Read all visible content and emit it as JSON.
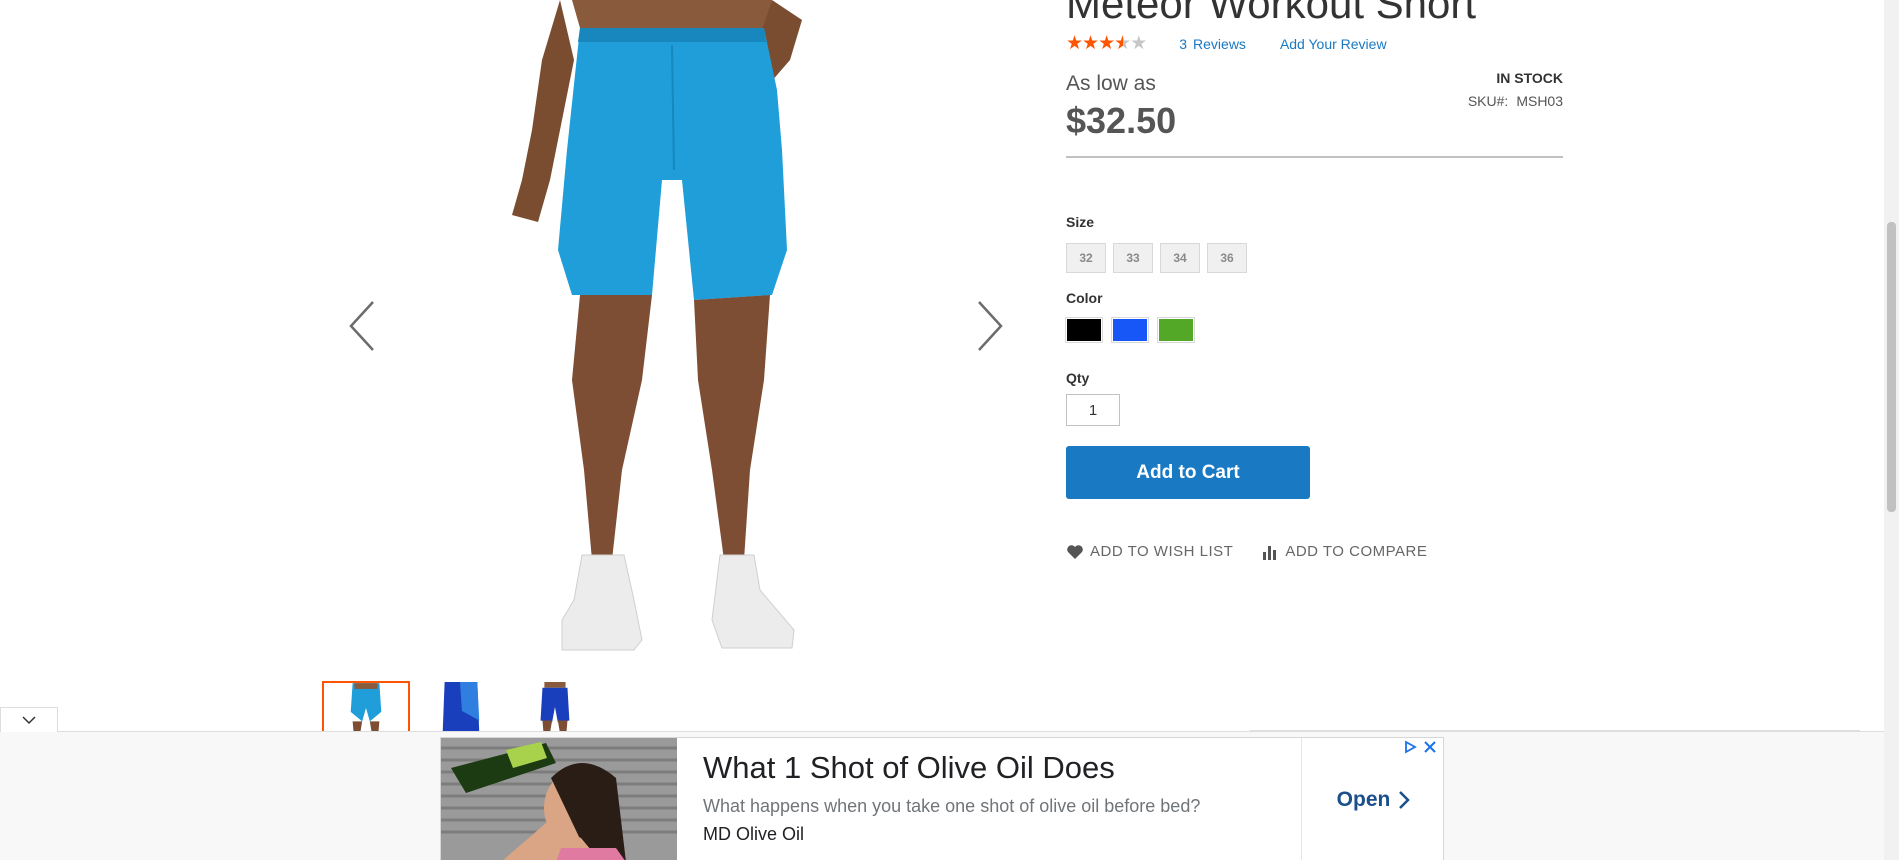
{
  "product": {
    "title": "Meteor Workout Short",
    "rating_percent": 70,
    "reviews_count": "3",
    "reviews_word": "Reviews",
    "add_review": "Add Your Review",
    "price_prefix": "As low as",
    "price": "$32.50",
    "stock": "IN STOCK",
    "sku_label": "SKU#:",
    "sku_value": "MSH03"
  },
  "options": {
    "size_label": "Size",
    "sizes": [
      "32",
      "33",
      "34",
      "36"
    ],
    "color_label": "Color",
    "colors": [
      {
        "name": "Black",
        "hex": "#000000"
      },
      {
        "name": "Blue",
        "hex": "#1857f7"
      },
      {
        "name": "Green",
        "hex": "#53a828"
      }
    ],
    "qty_label": "Qty",
    "qty_value": "1"
  },
  "actions": {
    "add_to_cart": "Add to Cart",
    "wishlist": "ADD TO WISH LIST",
    "compare": "ADD TO COMPARE"
  },
  "gallery": {
    "thumbnail_count": 3,
    "active_thumbnail": 0,
    "shorts_color": "#1f9ed9"
  },
  "ad": {
    "headline": "What 1 Shot of Olive Oil Does",
    "description": "What happens when you take one shot of olive oil before bed?",
    "advertiser": "MD Olive Oil",
    "cta": "Open"
  },
  "colors": {
    "accent": "#1979c3",
    "star": "#ff5501"
  }
}
